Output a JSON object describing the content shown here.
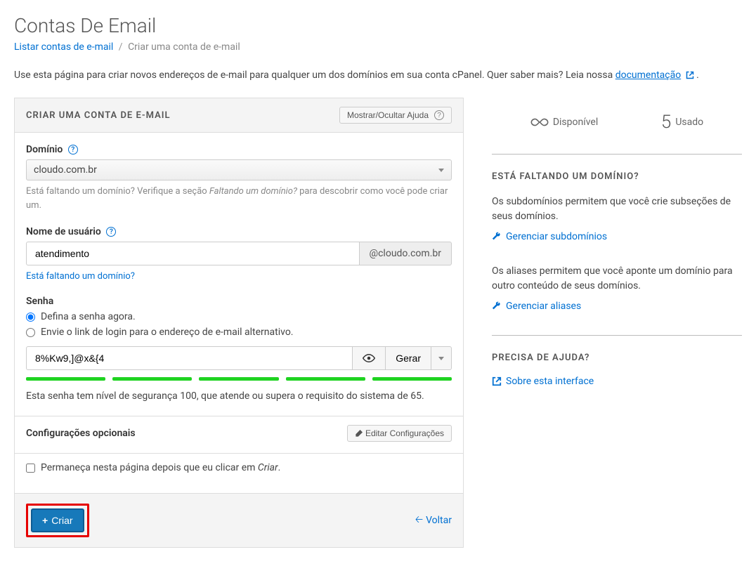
{
  "page": {
    "title": "Contas De Email"
  },
  "breadcrumb": {
    "list_link": "Listar contas de e-mail",
    "current": "Criar uma conta de e-mail"
  },
  "intro": {
    "text_before": "Use esta página para criar novos endereços de e-mail para qualquer um dos domínios em sua conta cPanel. Quer saber mais? Leia nossa ",
    "link": "documentação",
    "text_after": "."
  },
  "panel": {
    "title": "CRIAR UMA CONTA DE E-MAIL",
    "toggle_help": "Mostrar/Ocultar Ajuda"
  },
  "domain": {
    "label": "Domínio",
    "selected": "cloudo.com.br",
    "hint_before": "Está faltando um domínio? Verifique a seção ",
    "hint_em": "Faltando um domínio?",
    "hint_after": " para descobrir como você pode criar um."
  },
  "username": {
    "label": "Nome de usuário",
    "value": "atendimento",
    "suffix": "@cloudo.com.br",
    "missing_link": "Está faltando um domínio?"
  },
  "password": {
    "label": "Senha",
    "option_now": "Defina a senha agora.",
    "option_link": "Envie o link de login para o endereço de e-mail alternativo.",
    "value": "8%Kw9,]@x&{4",
    "generate": "Gerar",
    "strength_text": "Esta senha tem nível de segurança 100, que atende ou supera o requisito do sistema de 65."
  },
  "optional": {
    "title": "Configurações opcionais",
    "edit_btn": "Editar Configurações"
  },
  "footer": {
    "stay_label_before": "Permaneça nesta página depois que eu clicar em ",
    "stay_label_em": "Criar",
    "stay_label_after": ".",
    "create_btn": "Criar",
    "back_link": "Voltar"
  },
  "sidebar": {
    "stats": {
      "available_label": "Disponível",
      "used_value": "5",
      "used_label": "Usado"
    },
    "missing_domain": {
      "heading": "ESTÁ FALTANDO UM DOMÍNIO?",
      "subdomain_text": "Os subdomínios permitem que você crie subseções de seus domínios.",
      "subdomain_link": "Gerenciar subdomínios",
      "alias_text": "Os aliases permitem que você aponte um domínio para outro conteúdo de seus domínios.",
      "alias_link": "Gerenciar aliases"
    },
    "help": {
      "heading": "PRECISA DE AJUDA?",
      "about_link": "Sobre esta interface"
    }
  }
}
